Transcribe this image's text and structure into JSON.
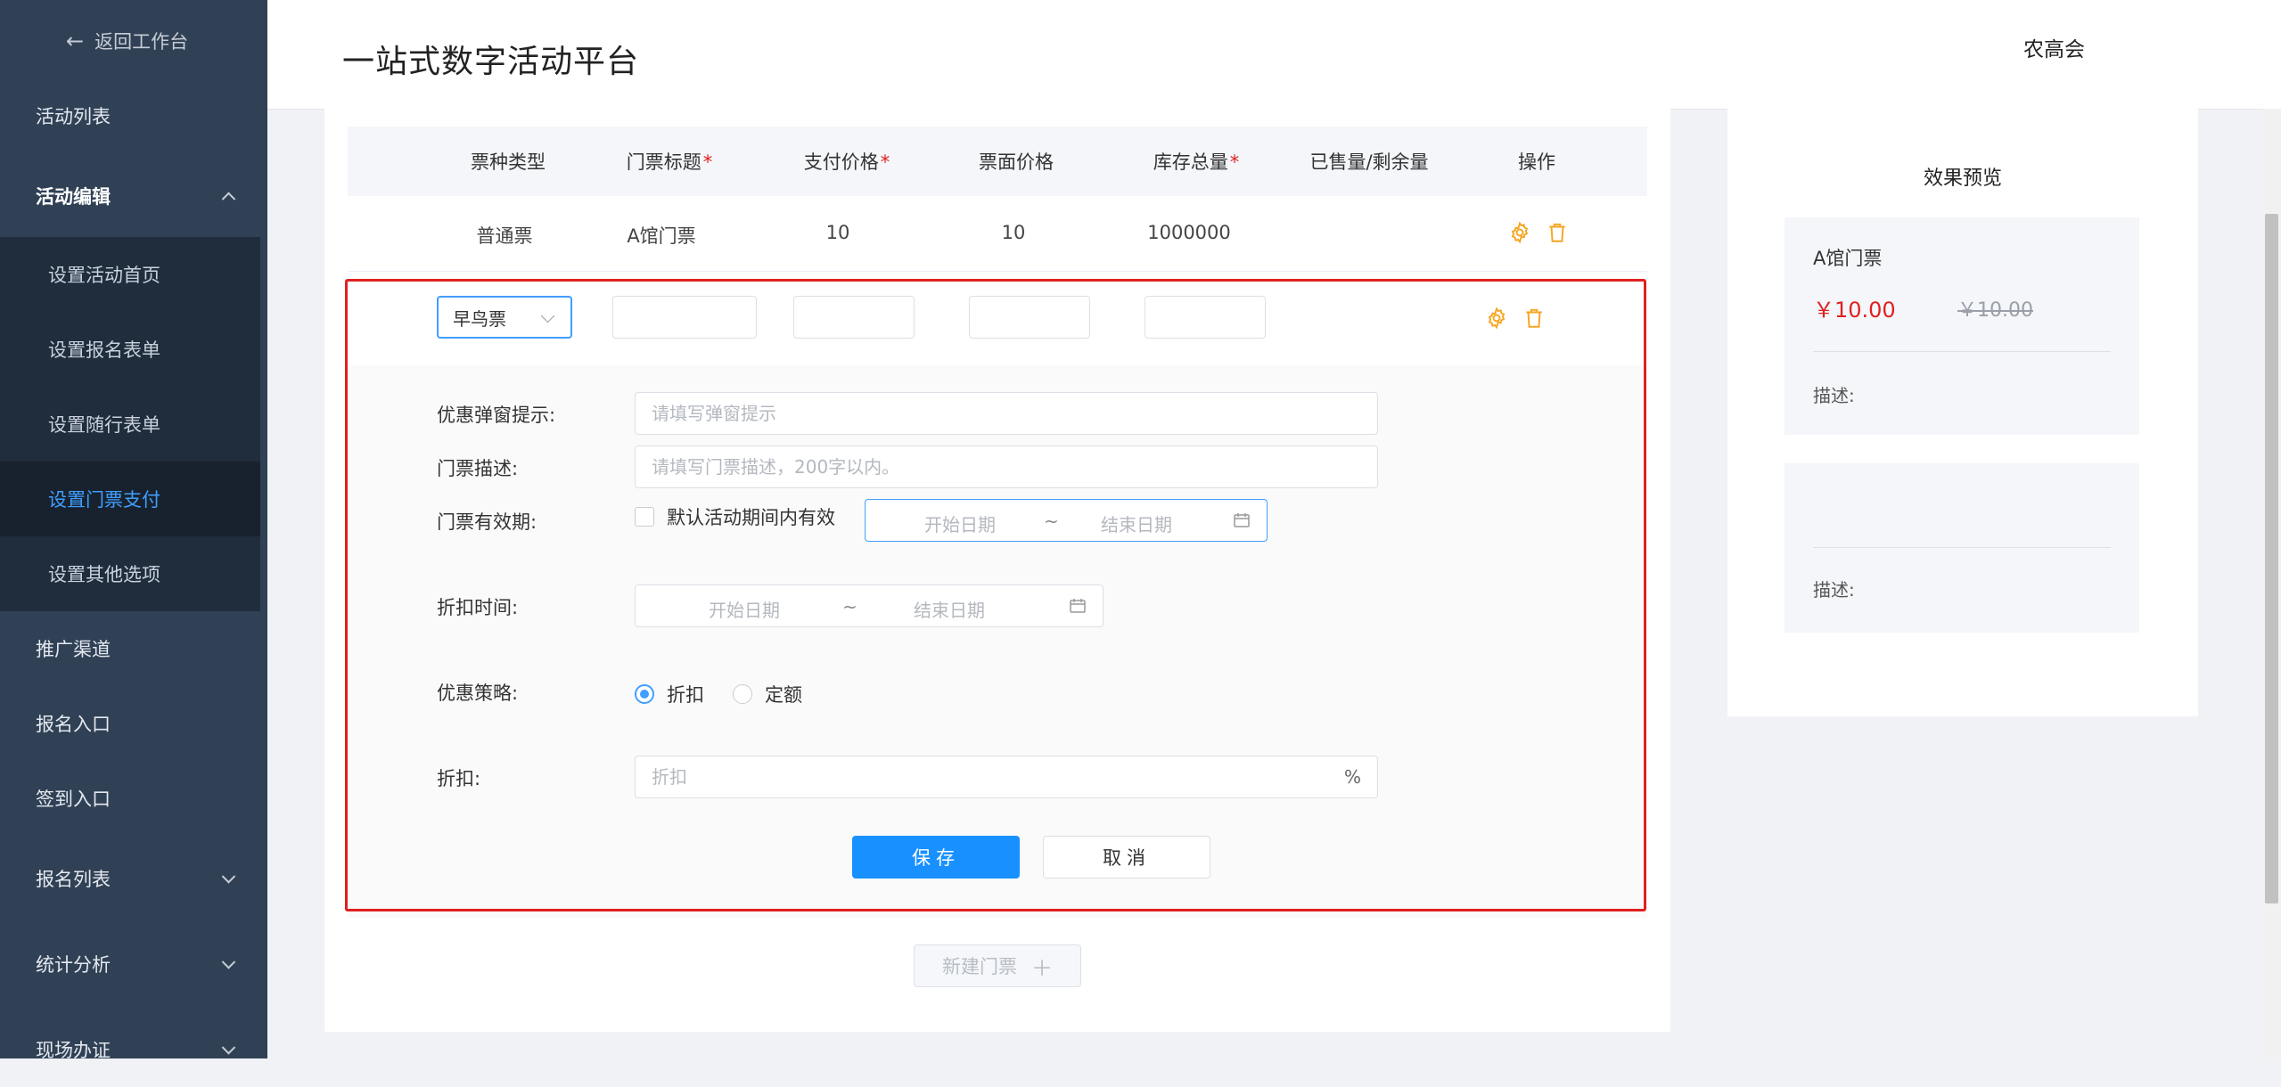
{
  "sidebar": {
    "back": "返回工作台",
    "items": {
      "activity_list": "活动列表",
      "activity_edit": "活动编辑",
      "promotion": "推广渠道",
      "signup_entry": "报名入口",
      "checkin_entry": "签到入口",
      "signup_list": "报名列表",
      "stats": "统计分析",
      "onsite": "现场办证"
    },
    "sub": {
      "home": "设置活动首页",
      "form": "设置报名表单",
      "companion": "设置随行表单",
      "ticket": "设置门票支付",
      "other": "设置其他选项"
    }
  },
  "header": {
    "title": "一站式数字活动平台",
    "user": "农高会"
  },
  "table": {
    "headers": {
      "type": "票种类型",
      "title": "门票标题",
      "pay": "支付价格",
      "face": "票面价格",
      "stock": "库存总量",
      "sold": "已售量/剩余量",
      "ops": "操作"
    },
    "required_mark": "*",
    "row": {
      "type": "普通票",
      "title": "A馆门票",
      "pay": "10",
      "face": "10",
      "stock": "1000000"
    }
  },
  "edit": {
    "type_value": "早鸟票",
    "labels": {
      "popup": "优惠弹窗提示:",
      "desc": "门票描述:",
      "validity": "门票有效期:",
      "discount_time": "折扣时间:",
      "strategy": "优惠策略:",
      "discount": "折扣:"
    },
    "placeholders": {
      "popup": "请填写弹窗提示",
      "desc": "请填写门票描述，200字以内。",
      "discount": "折扣"
    },
    "checkbox_label": "默认活动期间内有效",
    "date_start": "开始日期",
    "date_sep": "~",
    "date_end": "结束日期",
    "radio_discount": "折扣",
    "radio_fixed": "定额",
    "percent": "%",
    "save": "保存",
    "cancel": "取消"
  },
  "new_ticket": "新建门票",
  "preview": {
    "title": "效果预览",
    "card1_name": "A馆门票",
    "card1_price": "￥10.00",
    "card1_old": "￥10.00",
    "desc_label": "描述:"
  },
  "colors": {
    "accent": "#409eff",
    "sidebar": "#304156",
    "danger": "#e02020",
    "icon": "#f5a623"
  }
}
